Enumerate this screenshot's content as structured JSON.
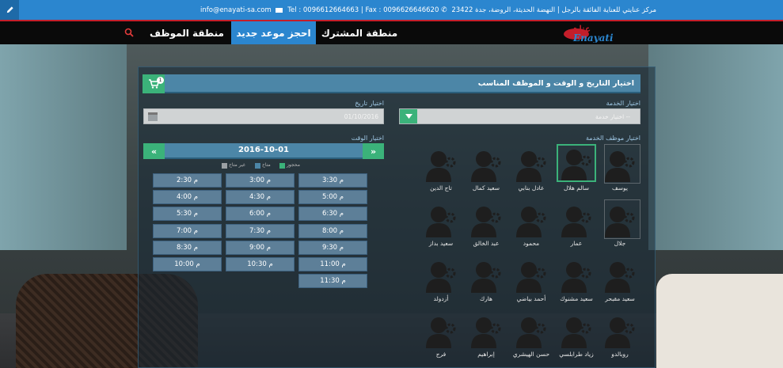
{
  "topbar": {
    "contact": "مركز عنايتي للعناية الفائقة بالرجل | النهضة الحديثة، الروضة، جدة 23422",
    "phones": "Tel : 0096612664663 | Fax : 0096626646620",
    "email": "info@enayati-sa.com"
  },
  "nav": {
    "items": [
      {
        "label": "منطقة المشترك",
        "active": false
      },
      {
        "label": "احجز موعد جديد",
        "active": true
      },
      {
        "label": "منطقة الموظف",
        "active": false
      }
    ],
    "logo_text": "عنايتي",
    "logo_text_latin": "Enayati"
  },
  "cart": {
    "count": "1"
  },
  "panel": {
    "title": "اختيار التاريخ و الوقت و الموظف المناسب",
    "service_label": "اختيار الخدمة",
    "service_placeholder": "-- اختيار خدمة",
    "date_label": "اختيار تاريخ",
    "date_value": "01/10/2016",
    "time_label": "اختيار الوقت",
    "staff_label": "اختيار موظف الخدمة",
    "current_date": "2016-10-01",
    "legend": [
      {
        "label": "محجوز",
        "color": "#3bb27a"
      },
      {
        "label": "متاح",
        "color": "#4c86a7"
      },
      {
        "label": "غير متاح",
        "color": "#9aa0a4"
      }
    ],
    "slots": [
      "3:30 م",
      "3:00 م",
      "2:30 م",
      "5:00 م",
      "4:30 م",
      "4:00 م",
      "6:30 م",
      "6:00 م",
      "5:30 م",
      "8:00 م",
      "7:30 م",
      "7:00 م",
      "9:30 م",
      "9:00 م",
      "8:30 م",
      "11:00 م",
      "10:30 م",
      "10:00 م",
      "11:30 م"
    ],
    "staff": [
      [
        "يوسف",
        "سالم هلال",
        "عادل بنابي",
        "سعيد كمال",
        "تاج الدين"
      ],
      [
        "جلال",
        "عمار",
        "محمود",
        "عبد الخالق",
        "سعيد بداز"
      ],
      [
        "سعيد مقبحر",
        "سعيد مشنوك",
        "أحمد بياضي",
        "هارك",
        "أزدولد"
      ],
      [
        "روبالدو",
        "زياد طرابلسي",
        "حسن الهيشري",
        "إبراهيم",
        "فرج"
      ]
    ]
  }
}
